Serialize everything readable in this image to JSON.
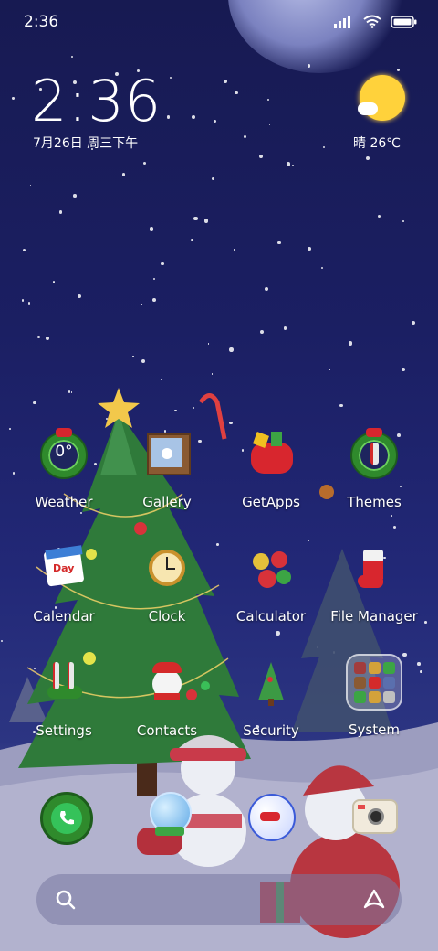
{
  "status_bar": {
    "time": "2:36",
    "signal_icon": "cellular-signal-icon",
    "wifi_icon": "wifi-icon",
    "battery_icon": "battery-icon"
  },
  "clock_widget": {
    "time": "2:36",
    "date": "7月26日 周三下午"
  },
  "weather_widget": {
    "text": "晴 26℃",
    "icon": "sun-cloud-icon"
  },
  "apps": [
    {
      "label": "Weather",
      "icon": "weather-wreath-icon"
    },
    {
      "label": "Gallery",
      "icon": "gallery-snowman-frame-icon"
    },
    {
      "label": "GetApps",
      "icon": "gift-sack-icon"
    },
    {
      "label": "Themes",
      "icon": "themes-wreath-icon"
    },
    {
      "label": "Calendar",
      "icon": "calendar-icon"
    },
    {
      "label": "Clock",
      "icon": "pocket-watch-icon"
    },
    {
      "label": "Calculator",
      "icon": "ornaments-icon"
    },
    {
      "label": "File Manager",
      "icon": "stocking-icon"
    },
    {
      "label": "Settings",
      "icon": "candy-cane-wreath-icon"
    },
    {
      "label": "Contacts",
      "icon": "snowman-head-icon"
    },
    {
      "label": "Security",
      "icon": "christmas-tree-icon"
    },
    {
      "label": "System",
      "icon": "folder-icon"
    }
  ],
  "weather_icon_text": "0°",
  "dock": [
    {
      "icon": "phone-wreath-icon"
    },
    {
      "icon": "snow-globe-icon"
    },
    {
      "icon": "bird-ornament-icon"
    },
    {
      "icon": "camera-icon"
    }
  ],
  "search": {
    "search_icon": "search-icon",
    "assistant_icon": "assistant-icon"
  },
  "colors": {
    "sky_top": "#171a52",
    "sky_bottom": "#2c3582",
    "snow_ground": "#8d8fb4",
    "sun": "#ffd23b"
  }
}
